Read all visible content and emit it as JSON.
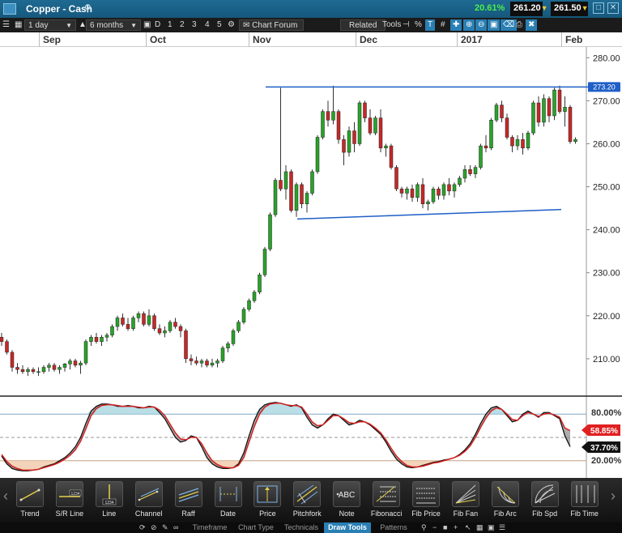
{
  "header": {
    "title": "Copper - Cash",
    "change_pct": "20.61%",
    "sell_price": "261.20",
    "buy_price": "261.50"
  },
  "toolbar": {
    "interval": "1 day",
    "range": "6 months",
    "periods": [
      "D",
      "1",
      "2",
      "3",
      "4",
      "5"
    ],
    "chart_forum": "Chart Forum",
    "related": "Related",
    "tools": "Tools"
  },
  "dates": [
    "Sep",
    "Oct",
    "Nov",
    "Dec",
    "2017",
    "Feb"
  ],
  "chart_data": {
    "type": "candlestick",
    "y_ticks": [
      "280.00",
      "270.00",
      "260.00",
      "250.00",
      "240.00",
      "230.00",
      "220.00",
      "210.00"
    ],
    "ylim": [
      201.5,
      282.5
    ],
    "current_price_label": "273.20",
    "resistance": 273.2,
    "support_start": 242.5,
    "support_end": 244.7,
    "candles": [
      [
        215,
        216,
        213,
        214
      ],
      [
        214,
        214.5,
        211,
        211.5
      ],
      [
        211.5,
        212,
        207,
        208
      ],
      [
        208,
        209,
        206.5,
        207.5
      ],
      [
        207.5,
        208.5,
        206.5,
        207
      ],
      [
        207,
        208,
        206,
        207.5
      ],
      [
        207.5,
        208,
        206.5,
        207
      ],
      [
        207,
        208,
        206,
        207
      ],
      [
        207,
        208.5,
        206.5,
        208
      ],
      [
        208,
        209,
        207,
        208.5
      ],
      [
        208.5,
        209,
        207,
        207.5
      ],
      [
        207.5,
        208.5,
        206.5,
        208
      ],
      [
        208,
        209,
        207,
        208.8
      ],
      [
        208.8,
        210,
        207.5,
        209.5
      ],
      [
        209.5,
        210,
        208,
        208.5
      ],
      [
        208.5,
        209.5,
        206.5,
        209
      ],
      [
        209,
        214.5,
        208.5,
        214
      ],
      [
        214,
        215.5,
        213,
        215
      ],
      [
        215,
        216,
        213.5,
        214
      ],
      [
        214,
        215.5,
        213,
        215
      ],
      [
        215,
        216,
        214,
        215.5
      ],
      [
        215.5,
        218,
        215,
        217.5
      ],
      [
        217.5,
        220,
        216.5,
        219.5
      ],
      [
        219.5,
        220.5,
        217.5,
        218
      ],
      [
        218,
        219.5,
        216.5,
        217
      ],
      [
        217,
        220,
        216.5,
        219.5
      ],
      [
        219.5,
        221,
        218.5,
        220.5
      ],
      [
        220.5,
        221,
        217.5,
        218
      ],
      [
        218,
        221.5,
        217.5,
        220
      ],
      [
        220,
        220.5,
        216.5,
        217
      ],
      [
        217,
        218,
        215.5,
        216
      ],
      [
        216,
        217.5,
        215,
        216.5
      ],
      [
        216.5,
        219,
        216,
        218.5
      ],
      [
        218.5,
        219.5,
        217,
        217.5
      ],
      [
        217.5,
        218,
        215,
        216.5
      ],
      [
        216.5,
        217,
        209,
        210
      ],
      [
        210,
        211,
        208.5,
        209.5
      ],
      [
        209.5,
        210.5,
        208.5,
        209
      ],
      [
        209,
        210,
        208,
        209.5
      ],
      [
        209.5,
        210,
        208,
        208.5
      ],
      [
        208.5,
        210,
        208,
        209
      ],
      [
        209,
        210,
        208,
        209.5
      ],
      [
        209.5,
        213,
        209,
        212.5
      ],
      [
        212.5,
        214,
        211.5,
        213.5
      ],
      [
        213.5,
        217,
        213,
        216.5
      ],
      [
        216.5,
        219,
        216,
        218.5
      ],
      [
        218.5,
        222,
        218,
        221.5
      ],
      [
        221.5,
        224,
        221,
        223.5
      ],
      [
        223.5,
        226,
        223,
        225.5
      ],
      [
        225.5,
        230,
        225,
        229.5
      ],
      [
        229.5,
        236,
        229,
        235.5
      ],
      [
        235.5,
        244,
        235,
        243.5
      ],
      [
        243.5,
        252,
        243,
        251.5
      ],
      [
        251.5,
        273,
        249,
        249.5
      ],
      [
        249.5,
        255,
        247,
        253.5
      ],
      [
        253.5,
        254,
        244,
        244.5
      ],
      [
        244.5,
        251,
        243,
        250.5
      ],
      [
        250.5,
        251,
        245,
        246
      ],
      [
        246,
        249,
        244,
        248.5
      ],
      [
        248.5,
        254,
        248,
        253.5
      ],
      [
        253.5,
        262,
        253,
        261.5
      ],
      [
        261.5,
        268,
        261,
        267.5
      ],
      [
        267.5,
        270,
        264,
        265.5
      ],
      [
        265.5,
        273.5,
        264.5,
        267.5
      ],
      [
        267.5,
        268,
        260,
        261
      ],
      [
        261,
        262,
        255,
        258
      ],
      [
        258,
        264,
        257,
        263
      ],
      [
        263,
        265,
        258,
        260
      ],
      [
        260,
        270,
        259.5,
        269.5
      ],
      [
        269.5,
        270,
        265,
        266
      ],
      [
        266,
        268,
        262,
        262.5
      ],
      [
        262.5,
        266.5,
        262,
        266
      ],
      [
        266,
        268,
        258,
        259
      ],
      [
        259,
        260,
        257,
        259.5
      ],
      [
        259.5,
        260,
        254,
        254.5
      ],
      [
        254.5,
        255,
        249,
        249.5
      ],
      [
        249.5,
        250,
        247.5,
        248.5
      ],
      [
        248.5,
        250,
        247,
        249.5
      ],
      [
        249.5,
        250.5,
        246.5,
        247.5
      ],
      [
        247.5,
        251,
        246.5,
        250.5
      ],
      [
        250.5,
        252,
        245,
        246
      ],
      [
        246,
        247,
        244.5,
        246.5
      ],
      [
        246.5,
        250,
        246,
        249.5
      ],
      [
        249.5,
        250,
        247,
        248
      ],
      [
        248,
        251,
        247,
        250.5
      ],
      [
        250.5,
        252,
        248,
        249
      ],
      [
        249,
        251,
        247.5,
        250.5
      ],
      [
        250.5,
        252.5,
        250,
        252
      ],
      [
        252,
        255,
        251,
        254
      ],
      [
        254,
        255,
        252.5,
        253
      ],
      [
        253,
        255,
        252,
        254.5
      ],
      [
        254.5,
        260,
        254,
        259.5
      ],
      [
        259.5,
        262,
        258,
        259
      ],
      [
        259,
        266,
        258.5,
        265.5
      ],
      [
        265.5,
        269.5,
        265,
        269
      ],
      [
        269,
        270,
        265,
        266
      ],
      [
        266,
        267,
        261,
        261.5
      ],
      [
        261.5,
        262,
        258,
        259.5
      ],
      [
        259.5,
        262,
        258.5,
        261
      ],
      [
        261,
        262.5,
        257.5,
        259
      ],
      [
        259,
        263,
        258.5,
        262.5
      ],
      [
        262.5,
        270,
        262,
        269.5
      ],
      [
        269.5,
        271,
        264,
        265
      ],
      [
        265,
        271.5,
        264,
        270.5
      ],
      [
        270.5,
        271,
        265,
        266.5
      ],
      [
        266.5,
        273,
        265.5,
        272.5
      ],
      [
        272.5,
        273.5,
        267,
        267.5
      ],
      [
        267.5,
        271,
        264,
        268.5
      ],
      [
        268.5,
        269,
        260,
        260.5
      ],
      [
        260.5,
        261.5,
        260,
        261
      ]
    ]
  },
  "oscillator": {
    "labels": [
      "80.00%",
      "20.00%"
    ],
    "red_value": "58.85%",
    "black_value": "37.70%",
    "black_line": [
      26,
      16,
      10,
      8,
      7,
      7,
      8,
      9,
      12,
      14,
      16,
      20,
      24,
      30,
      38,
      50,
      68,
      84,
      90,
      93,
      93,
      92,
      90,
      90,
      91,
      90,
      88,
      88,
      90,
      89,
      82,
      74,
      62,
      50,
      44,
      46,
      52,
      50,
      38,
      24,
      16,
      12,
      10,
      10,
      11,
      16,
      30,
      52,
      72,
      86,
      92,
      94,
      95,
      94,
      92,
      90,
      92,
      88,
      76,
      66,
      62,
      66,
      74,
      80,
      78,
      72,
      66,
      68,
      72,
      70,
      66,
      60,
      54,
      44,
      32,
      22,
      16,
      12,
      11,
      12,
      14,
      16,
      18,
      19,
      21,
      22,
      24,
      28,
      34,
      42,
      54,
      68,
      80,
      88,
      90,
      86,
      78,
      70,
      72,
      80,
      84,
      80,
      76,
      82,
      82,
      78,
      74,
      52,
      38
    ],
    "red_line": [
      28,
      19,
      13,
      10,
      8,
      8,
      8,
      9,
      11,
      13,
      15,
      18,
      22,
      27,
      34,
      45,
      61,
      78,
      87,
      91,
      92,
      92,
      91,
      90,
      90,
      90,
      89,
      88,
      89,
      89,
      85,
      78,
      67,
      56,
      48,
      47,
      50,
      50,
      42,
      30,
      20,
      15,
      12,
      11,
      11,
      14,
      24,
      44,
      64,
      80,
      89,
      93,
      94,
      94,
      92,
      91,
      91,
      89,
      80,
      70,
      65,
      66,
      72,
      78,
      78,
      74,
      69,
      68,
      70,
      70,
      67,
      62,
      56,
      47,
      36,
      26,
      19,
      14,
      12,
      12,
      13,
      15,
      17,
      18,
      20,
      22,
      24,
      27,
      32,
      39,
      50,
      63,
      75,
      84,
      88,
      86,
      80,
      73,
      72,
      78,
      82,
      80,
      77,
      80,
      81,
      79,
      76,
      62,
      58.85
    ]
  },
  "draw_tools": [
    {
      "label": "Trend",
      "icon": "trend-icon"
    },
    {
      "label": "S/R Line",
      "icon": "sr-line-icon"
    },
    {
      "label": "Line",
      "icon": "line-icon"
    },
    {
      "label": "Channel",
      "icon": "channel-icon"
    },
    {
      "label": "Raff",
      "icon": "raff-icon"
    },
    {
      "label": "Date",
      "icon": "date-icon"
    },
    {
      "label": "Price",
      "icon": "price-icon"
    },
    {
      "label": "Pitchfork",
      "icon": "pitchfork-icon"
    },
    {
      "label": "Note",
      "icon": "note-icon"
    },
    {
      "label": "Fibonacci",
      "icon": "fibonacci-icon"
    },
    {
      "label": "Fib Price",
      "icon": "fib-price-icon"
    },
    {
      "label": "Fib Fan",
      "icon": "fib-fan-icon"
    },
    {
      "label": "Fib Arc",
      "icon": "fib-arc-icon"
    },
    {
      "label": "Fib Spd",
      "icon": "fib-spd-icon"
    },
    {
      "label": "Fib Time",
      "icon": "fib-time-icon"
    }
  ],
  "tool_icon_text": {
    "sr_value": "1234",
    "line_value": "1234",
    "note": "ABC"
  },
  "tabs": [
    "Timeframe",
    "Chart Type",
    "Technicals",
    "Draw Tools",
    "Patterns"
  ],
  "colors": {
    "up": "#29a329",
    "down": "#c62828",
    "accent": "#2a7fb4",
    "trendline": "#1f5fc7"
  }
}
